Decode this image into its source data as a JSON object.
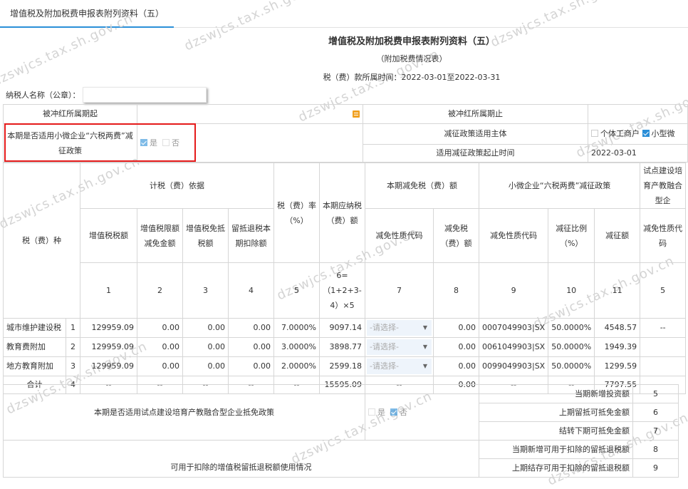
{
  "tab": {
    "label": "增值税及附加税费申报表附列资料（五）"
  },
  "watermark": "dzswjcs.tax.sh.gov.cn",
  "header": {
    "title": "增值税及附加税费申报表附列资料（五）",
    "subtitle": "（附加税费情况表）",
    "period": "税（费）款所属时间：2022-03-01至2022-03-31",
    "taxpayer_label": "纳税人名称（公章）："
  },
  "top": {
    "red_start_label": "被冲红所属期起",
    "red_end_label": "被冲红所属期止",
    "small_policy_label": "本期是否适用小微企业“六税两费”减征政策",
    "yes_label": "是",
    "no_label": "否",
    "subject_label": "减征政策适用主体",
    "subject_opt1": "个体工商户",
    "subject_opt2": "小型微",
    "start_time_label": "适用减征政策起止时间",
    "start_time_value": "2022-03-01"
  },
  "table": {
    "col_tax_type": "税（费）种",
    "grp_basis": "计税（费）依据",
    "grp_reduce": "本期减免税（费）额",
    "grp_small": "小微企业“六税两费”减征政策",
    "grp_pilot": "试点建设培育产教融合型企",
    "h_vat": "增值税税额",
    "h_vat_limit": "增值税限额减免金额",
    "h_vat_exempt": "增值税免抵税额",
    "h_refund": "留抵退税本期扣除额",
    "h_rate": "税（费）率（%）",
    "h_payable": "本期应纳税（费）额",
    "h_reduce_code": "减免性质代码",
    "h_reduce_amt": "减免税（费）额",
    "h_small_code": "减免性质代码",
    "h_small_ratio": "减征比例（%）",
    "h_small_amt": "减征额",
    "h_pilot_code": "减免性质代码",
    "n1": "1",
    "n2": "2",
    "n3": "3",
    "n4": "4",
    "n5": "5",
    "n6": "6=（1+2+3-4）×5",
    "n7": "7",
    "n8": "8",
    "n9": "9",
    "n10": "10",
    "n11": "11",
    "rows": [
      {
        "name": "城市维护建设税",
        "idx": "1",
        "vat": "129959.09",
        "limit": "0.00",
        "exempt": "0.00",
        "refund": "0.00",
        "rate": "7.0000%",
        "payable": "9097.14",
        "reduce_code": "-请选择-",
        "reduce_amt": "0.00",
        "small_code": "0007049903|SX",
        "ratio": "50.0000%",
        "small_amt": "4548.57",
        "pilot": "--"
      },
      {
        "name": "教育费附加",
        "idx": "2",
        "vat": "129959.09",
        "limit": "0.00",
        "exempt": "0.00",
        "refund": "0.00",
        "rate": "3.0000%",
        "payable": "3898.77",
        "reduce_code": "-请选择-",
        "reduce_amt": "0.00",
        "small_code": "0061049903|SX",
        "ratio": "50.0000%",
        "small_amt": "1949.39",
        "pilot": ""
      },
      {
        "name": "地方教育附加",
        "idx": "3",
        "vat": "129959.09",
        "limit": "0.00",
        "exempt": "0.00",
        "refund": "0.00",
        "rate": "2.0000%",
        "payable": "2599.18",
        "reduce_code": "-请选择-",
        "reduce_amt": "0.00",
        "small_code": "0099049903|SX",
        "ratio": "50.0000%",
        "small_amt": "1299.59",
        "pilot": ""
      }
    ],
    "total": {
      "name": "合计",
      "idx": "4",
      "dash": "--",
      "payable": "15595.09",
      "reduce_amt": "0.00",
      "small_amt": "7797.55"
    }
  },
  "bottom": {
    "pilot_policy_label": "本期是否适用试点建设培育产教融合型企业抵免政策",
    "yes_label": "是",
    "no_label": "否",
    "refund_usage_label": "可用于扣除的增值税留抵退税额使用情况",
    "lines": [
      {
        "label": "当期新增投资额",
        "no": "5"
      },
      {
        "label": "上期留抵可抵免金额",
        "no": "6"
      },
      {
        "label": "结转下期可抵免金额",
        "no": "7"
      },
      {
        "label": "当期新增可用于扣除的留抵退税额",
        "no": "8"
      },
      {
        "label": "上期结存可用于扣除的留抵退税额",
        "no": "9"
      }
    ]
  }
}
